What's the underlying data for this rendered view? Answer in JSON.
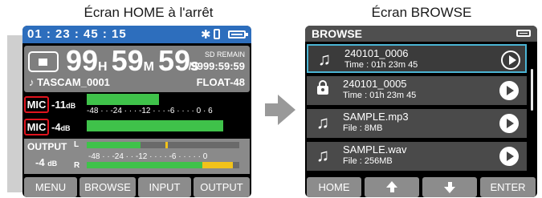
{
  "captions": {
    "left": "Écran HOME à l'arrêt",
    "right": "Écran BROWSE"
  },
  "home": {
    "timecode": "01 : 23 : 45 : 15",
    "status_icons": [
      "bluetooth-icon",
      "sd-card-icon",
      "battery-icon"
    ],
    "transport_icon": "stop-icon",
    "elapsed": {
      "h": "99",
      "h_unit": "H",
      "m": "59",
      "m_unit": "M",
      "s": "59",
      "s_unit": "S"
    },
    "remain_label": "SD REMAIN",
    "remain_value": "/9999:59:59",
    "project_name": "♪ TASCAM_0001",
    "format": "FLOAT-48",
    "mic1": {
      "label": "MIC",
      "level": "-11",
      "unit": "dB",
      "meter": 0.45
    },
    "mic2": {
      "label": "MIC",
      "level": "-4",
      "unit": "dB",
      "meter": 0.85
    },
    "mic_scale": "-48 · · -24 · · · -12 · · · -6 · · · · 0 · 6",
    "output": {
      "label": "OUTPUT",
      "level": "-4",
      "unit": "dB",
      "left_label": "L",
      "right_label": "R",
      "scale": "-48 · · -24 · · -12 · · · · -6 · · · · · 0",
      "left_meter": 0.35,
      "right_meter": 0.8
    },
    "softkeys": [
      "MENU",
      "BROWSE",
      "INPUT",
      "OUTPUT"
    ]
  },
  "browse": {
    "title": "BROWSE",
    "files": [
      {
        "icon": "music-note-icon",
        "name": "240101_0006",
        "sub": "Time : 01h 23m 45",
        "selected": true
      },
      {
        "icon": "lock-icon",
        "name": "240101_0005",
        "sub": "Time : 01h 23m 45",
        "selected": false
      },
      {
        "icon": "music-note-icon",
        "name": "SAMPLE.mp3",
        "sub": "File : 8MB",
        "selected": false
      },
      {
        "icon": "music-note-icon",
        "name": "SAMPLE.wav",
        "sub": "File : 256MB",
        "selected": false
      }
    ],
    "softkeys": {
      "home": "HOME",
      "up": "up-arrow-icon",
      "down": "down-arrow-icon",
      "enter": "ENTER"
    }
  },
  "colors": {
    "home_header": "#2d6ebd",
    "mic_border": "#e0141e",
    "meter_green": "#3fc24a",
    "meter_yellow": "#f2c21a",
    "selection": "#4bb4d4"
  }
}
